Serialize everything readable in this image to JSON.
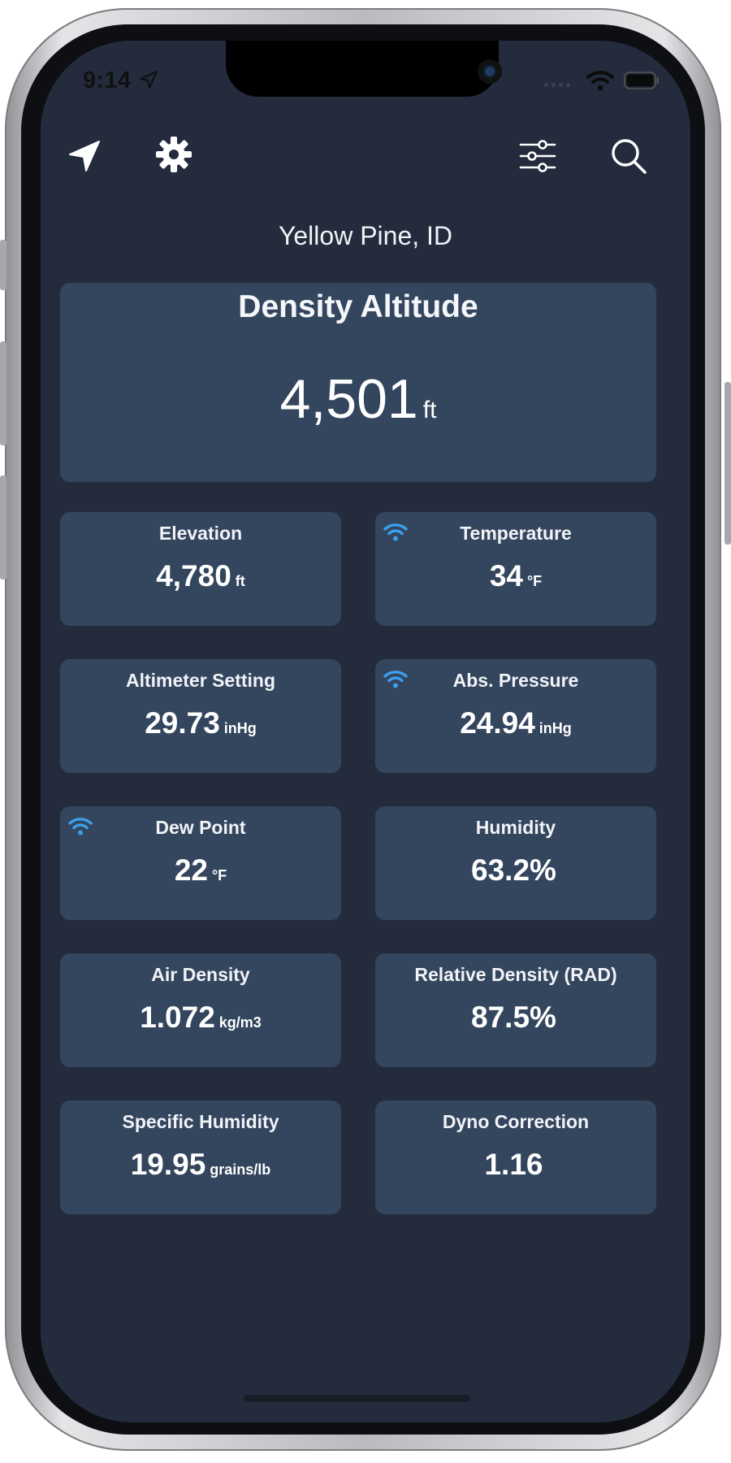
{
  "status_bar": {
    "time": "9:14"
  },
  "toolbar": {
    "location_icon": "location-arrow-icon",
    "settings_icon": "gear-icon",
    "filters_icon": "sliders-icon",
    "search_icon": "search-icon"
  },
  "location": "Yellow Pine, ID",
  "density_altitude": {
    "title": "Density Altitude",
    "value": "4,501",
    "unit": "ft"
  },
  "cards": [
    {
      "title": "Elevation",
      "value": "4,780",
      "unit": "ft",
      "live": false
    },
    {
      "title": "Temperature",
      "value": "34",
      "unit": "°F",
      "live": true
    },
    {
      "title": "Altimeter Setting",
      "value": "29.73",
      "unit": "inHg",
      "live": false
    },
    {
      "title": "Abs. Pressure",
      "value": "24.94",
      "unit": "inHg",
      "live": true
    },
    {
      "title": "Dew Point",
      "value": "22",
      "unit": "°F",
      "live": true
    },
    {
      "title": "Humidity",
      "value": "63.2%",
      "unit": "",
      "live": false
    },
    {
      "title": "Air Density",
      "value": "1.072",
      "unit": "kg/m3",
      "live": false
    },
    {
      "title": "Relative Density (RAD)",
      "value": "87.5%",
      "unit": "",
      "live": false
    },
    {
      "title": "Specific Humidity",
      "value": "19.95",
      "unit": "grains/lb",
      "live": false
    },
    {
      "title": "Dyno Correction",
      "value": "1.16",
      "unit": "",
      "live": false
    }
  ],
  "colors": {
    "background": "#232b3d",
    "card": "#33465e",
    "text": "#ffffff",
    "live_icon": "#3aa0ee"
  }
}
